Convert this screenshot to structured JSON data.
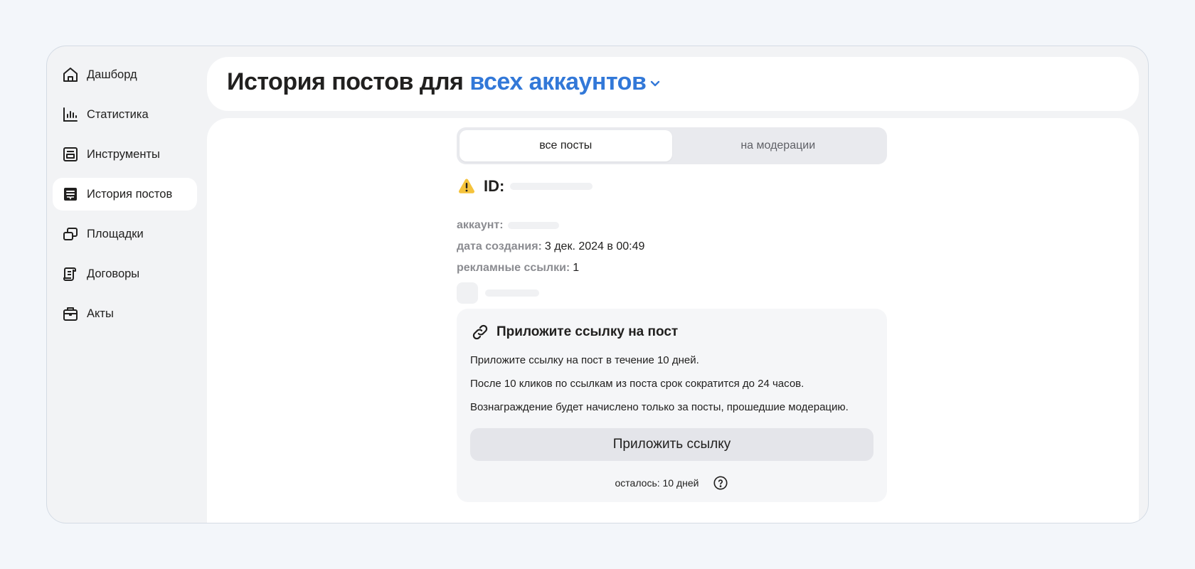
{
  "sidebar": {
    "items": [
      {
        "label": "Дашборд",
        "icon": "home-icon"
      },
      {
        "label": "Статистика",
        "icon": "bar-chart-icon"
      },
      {
        "label": "Инструменты",
        "icon": "tools-icon"
      },
      {
        "label": "История постов",
        "icon": "post-history-icon",
        "active": true
      },
      {
        "label": "Площадки",
        "icon": "platforms-icon"
      },
      {
        "label": "Договоры",
        "icon": "contract-icon"
      },
      {
        "label": "Акты",
        "icon": "briefcase-icon"
      }
    ]
  },
  "header": {
    "title_prefix": "История постов для",
    "account_selector": "всех аккаунтов"
  },
  "tabs": [
    {
      "label": "все посты",
      "active": true
    },
    {
      "label": "на модерации",
      "active": false
    }
  ],
  "post": {
    "id_label": "ID:",
    "account_label": "аккаунт:",
    "created_label": "дата создания:",
    "created_value": "3 дек. 2024 в 00:49",
    "links_label": "рекламные ссылки:",
    "links_value": "1"
  },
  "attach_card": {
    "title": "Приложите ссылку на пост",
    "lines": [
      "Приложите ссылку на пост в течение 10 дней.",
      "После 10 кликов по ссылкам из поста срок сократится до 24 часов.",
      "Вознаграждение будет начислено только за посты, прошедшие модерацию."
    ],
    "button_label": "Приложить ссылку",
    "remaining_text": "осталось: 10 дней"
  },
  "colors": {
    "accent": "#3278d8",
    "warning": "#f5c33b",
    "page_bg": "#f3f6fa"
  }
}
